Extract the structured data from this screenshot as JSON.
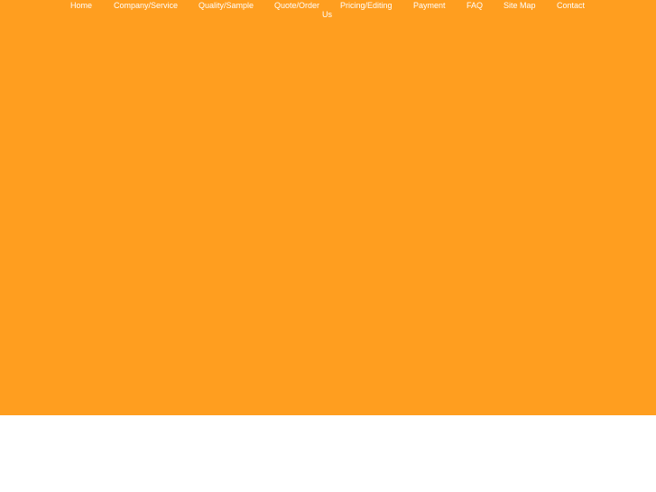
{
  "nav": {
    "items": [
      {
        "label": "Home"
      },
      {
        "label": "Company/Service"
      },
      {
        "label": "Quality/Sample"
      },
      {
        "label": "Quote/Order"
      },
      {
        "label": "Pricing/Editing"
      },
      {
        "label": "Payment"
      },
      {
        "label": "FAQ"
      },
      {
        "label": "Site Map"
      },
      {
        "label": "Contact Us"
      }
    ]
  },
  "colors": {
    "banner": "#ff9e1f",
    "nav_text": "#ffffff",
    "page_background": "#ffffff"
  }
}
